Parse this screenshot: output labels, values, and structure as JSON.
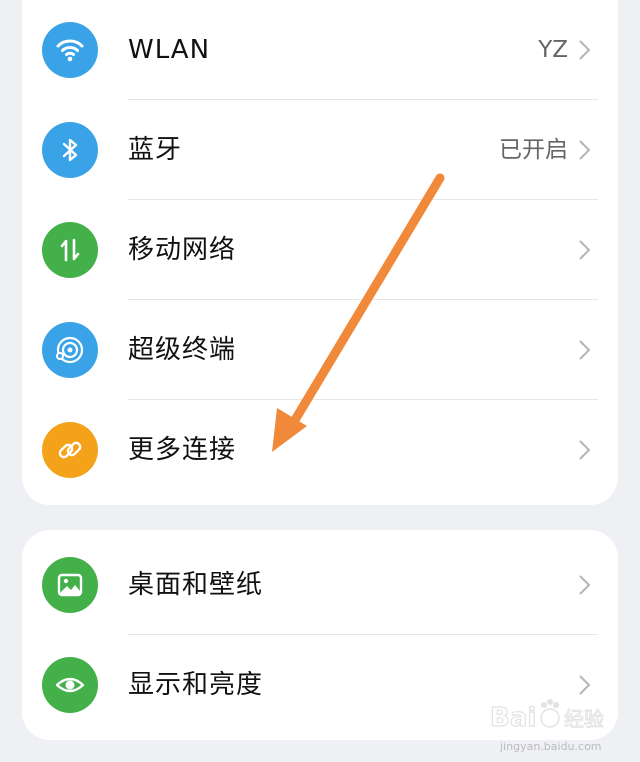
{
  "group1": [
    {
      "label": "WLAN",
      "value": "YZ",
      "icon": "wifi-icon",
      "color": "#3aa3e8"
    },
    {
      "label": "蓝牙",
      "value": "已开启",
      "icon": "bluetooth-icon",
      "color": "#3aa3e8"
    },
    {
      "label": "移动网络",
      "value": "",
      "icon": "mobile-data-icon",
      "color": "#43b04a"
    },
    {
      "label": "超级终端",
      "value": "",
      "icon": "super-device-icon",
      "color": "#3aa3e8"
    },
    {
      "label": "更多连接",
      "value": "",
      "icon": "link-icon",
      "color": "#f5a21b"
    }
  ],
  "group2": [
    {
      "label": "桌面和壁纸",
      "value": "",
      "icon": "wallpaper-icon",
      "color": "#43b04a"
    },
    {
      "label": "显示和亮度",
      "value": "",
      "icon": "eye-icon",
      "color": "#43b04a"
    }
  ],
  "annotation": {
    "arrow_color": "#f08a3a"
  },
  "watermark": {
    "text": "Baidu 经验",
    "sub": "jingyan.baidu.com"
  }
}
